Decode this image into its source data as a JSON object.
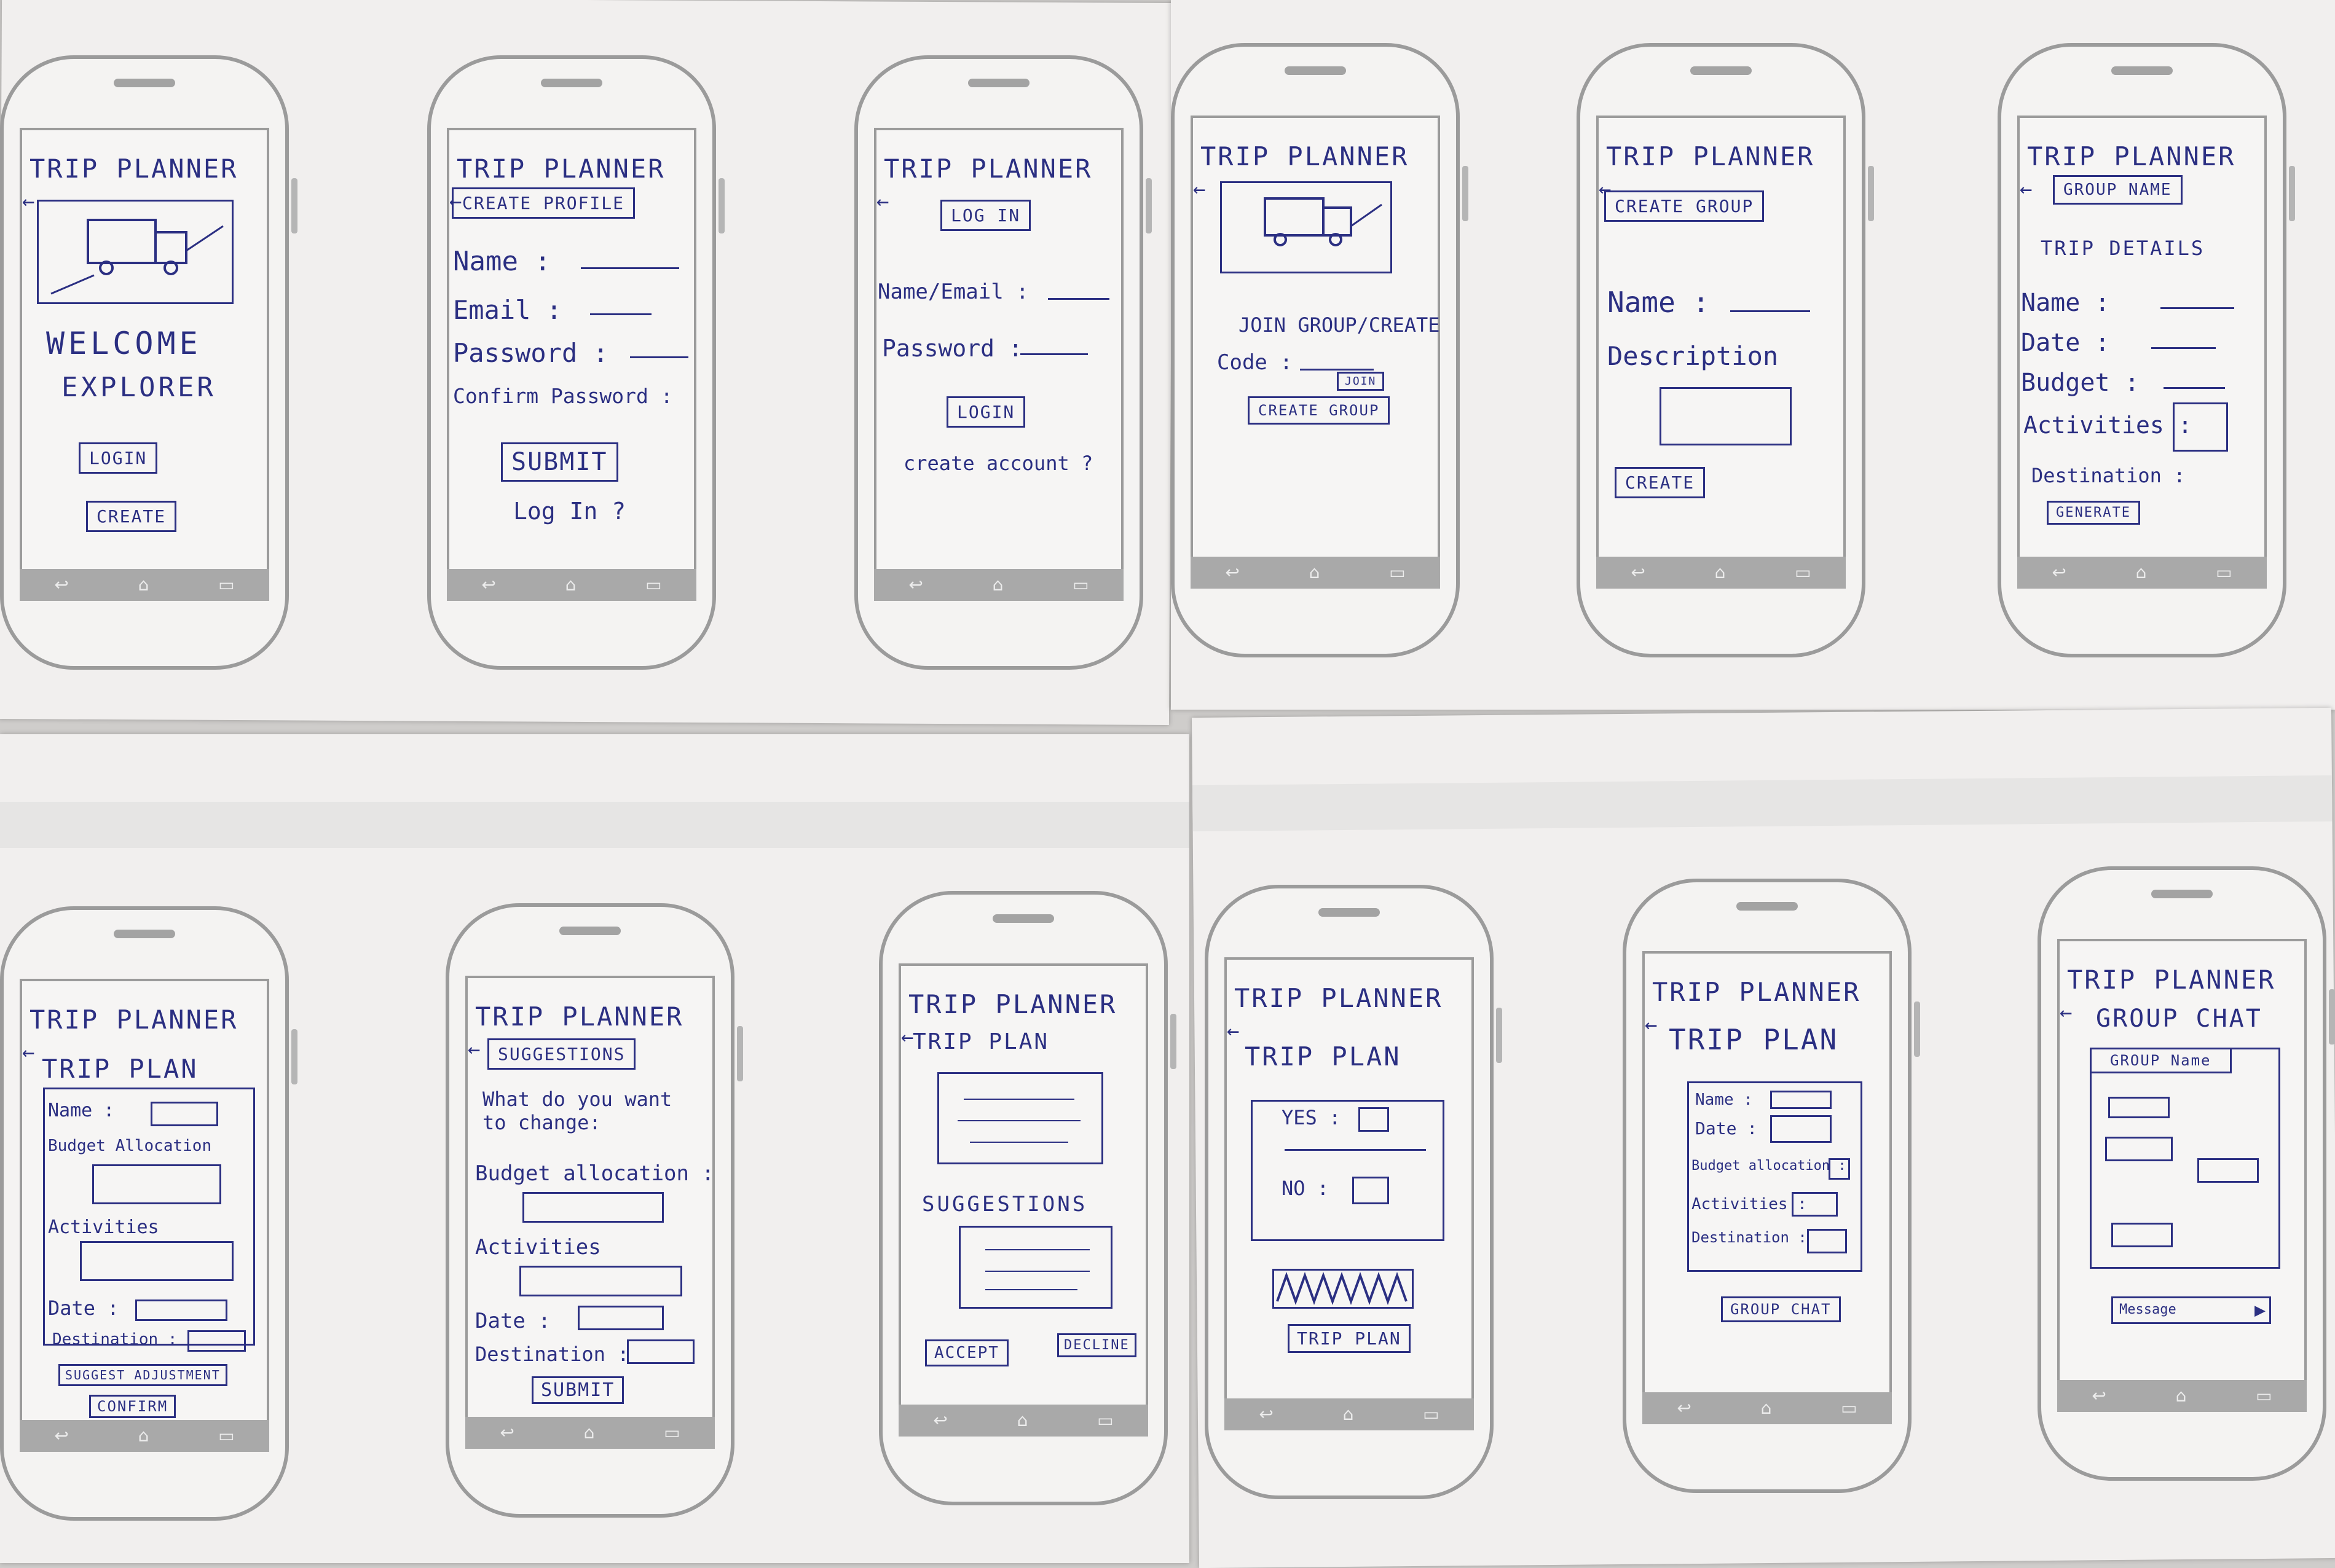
{
  "app": {
    "title": "TRIP PLANNER",
    "back_glyph": "←",
    "nav_icons": [
      "back-icon",
      "home-icon",
      "recents-icon"
    ]
  },
  "screens": {
    "welcome": {
      "heading_1": "WELCOME",
      "heading_2": "EXPLORER",
      "login_button": "LOGIN",
      "create_button": "CREATE"
    },
    "create_profile": {
      "header_button": "CREATE PROFILE",
      "name_label": "Name :",
      "email_label": "Email :",
      "password_label": "Password :",
      "confirm_label": "Confirm Password :",
      "submit_button": "SUBMIT",
      "login_link": "Log In ?"
    },
    "login": {
      "header_button": "LOG IN",
      "name_label": "Name/Email :",
      "password_label": "Password :",
      "login_button": "LOGIN",
      "create_link": "create account ?"
    },
    "join_group": {
      "heading": "JOIN GROUP/CREATE",
      "code_label": "Code :",
      "join_button": "JOIN",
      "create_group_button": "CREATE GROUP"
    },
    "create_group": {
      "header_button": "CREATE GROUP",
      "name_label": "Name :",
      "description_label": "Description",
      "create_button": "CREATE"
    },
    "trip_details": {
      "group_name_button": "GROUP NAME",
      "heading": "TRIP DETAILS",
      "name_label": "Name :",
      "date_label": "Date :",
      "budget_label": "Budget :",
      "activities_label": "Activities :",
      "destination_label": "Destination :",
      "generate_button": "GENERATE"
    },
    "trip_plan": {
      "heading": "TRIP PLAN",
      "name_label": "Name :",
      "budget_label": "Budget Allocation",
      "activities_label": "Activities",
      "date_label": "Date :",
      "destination_label": "Destination :",
      "suggest_button": "SUGGEST ADJUSTMENT",
      "confirm_button": "CONFIRM"
    },
    "suggestions": {
      "header_button": "SUGGESTIONS",
      "question": "What do you want to change:",
      "budget_label": "Budget allocation :",
      "activities_label": "Activities",
      "date_label": "Date :",
      "destination_label": "Destination :",
      "submit_button": "SUBMIT"
    },
    "review": {
      "heading": "TRIP PLAN",
      "suggestions_label": "SUGGESTIONS",
      "accept_button": "ACCEPT",
      "decline_button": "DECLINE"
    },
    "vote": {
      "heading": "TRIP PLAN",
      "yes_label": "YES :",
      "no_label": "NO :",
      "trip_plan_button": "TRIP PLAN"
    },
    "final_plan": {
      "heading": "TRIP PLAN",
      "name_label": "Name :",
      "date_label": "Date :",
      "budget_label": "Budget allocation :",
      "activities_label": "Activities :",
      "destination_label": "Destination :",
      "group_chat_button": "GROUP CHAT"
    },
    "group_chat": {
      "heading": "GROUP CHAT",
      "group_name": "GROUP Name",
      "message_placeholder": "Message",
      "send_glyph": "▶"
    }
  }
}
